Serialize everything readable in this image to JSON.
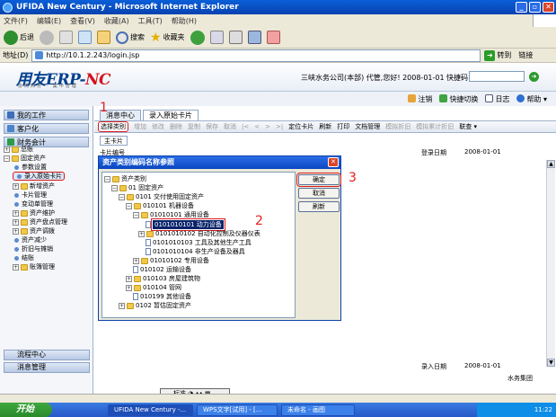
{
  "browser": {
    "title": "UFIDA New Century - Microsoft Internet Explorer",
    "menu": [
      "文件(F)",
      "编辑(E)",
      "查看(V)",
      "收藏(A)",
      "工具(T)",
      "帮助(H)"
    ],
    "toolbar": {
      "back": "后退",
      "search": "搜索",
      "favorites": "收藏夹"
    },
    "address_label": "地址(D)",
    "address_value": "http://10.1.2.243/login.jsp",
    "go_label": "转到",
    "links_label": "链接"
  },
  "erp": {
    "logo_main": "用友ERP-",
    "logo_nc": "NC",
    "logo_sub": "协同商务 · 集中管理",
    "user_info": "三峡水务公司(本部) 代管,您好! 2008-01-01",
    "quick_code_label": "快捷码",
    "links": [
      "注销",
      "快捷切换",
      "日志",
      "帮助"
    ]
  },
  "nav": {
    "section_work": "我的工作",
    "section_customer": "客户化",
    "section_finance": "财务会计",
    "tree": [
      "总账",
      "固定资产",
      "参数设置",
      "录入原始卡片",
      "新增资产",
      "卡片管理",
      "变动单管理",
      "资产维护",
      "资产盘点管理",
      "资产调拨",
      "资产减少",
      "折旧与摊销",
      "结账",
      "账簿管理"
    ],
    "section_flow": "流程中心",
    "section_msg": "消息管理"
  },
  "content": {
    "tabs": [
      "消息中心",
      "录入原始卡片"
    ],
    "toolbar": [
      "选择类别",
      "增加",
      "修改",
      "删除",
      "复制",
      "保存",
      "取消",
      "|<",
      "<",
      ">",
      ">|",
      "定位卡片",
      "刷新",
      "打印",
      "文档管理",
      "模拟折旧",
      "模拟累计折旧",
      "联查"
    ],
    "subtab": "主卡片",
    "card_number_label": "卡片编号",
    "login_date_label": "登录日期",
    "login_date_value": "2008-01-01",
    "entry_date_label": "录入日期",
    "entry_date_value": "2008-01-01",
    "company": "水务集团"
  },
  "dialog": {
    "title": "资产类别编码名称参照",
    "buttons": {
      "ok": "确定",
      "cancel": "取消",
      "refresh": "刷新"
    },
    "tree": [
      "资产类别",
      "01 固定资产",
      "0101 交付使用固定资产",
      "010101 机器设备",
      "01010101 通用设备",
      "0101010101 动力设备",
      "0101010102 自动化控制及仪器仪表",
      "0101010103 工具及其他生产工具",
      "0101010104 非生产设备及器具",
      "01010102 专用设备",
      "010102 运输设备",
      "010103 房屋建筑物",
      "010104 管网",
      "010199 其他设备",
      "0102 暂估固定资产"
    ]
  },
  "annotations": [
    "1",
    "2",
    "3"
  ],
  "ime": {
    "label": "标准"
  },
  "taskbar": {
    "start": "开始",
    "tasks": [
      "UFIDA New Century -...",
      "WPS文字[试用] - [...",
      "未命名 - 画图"
    ],
    "time": "11:22"
  }
}
